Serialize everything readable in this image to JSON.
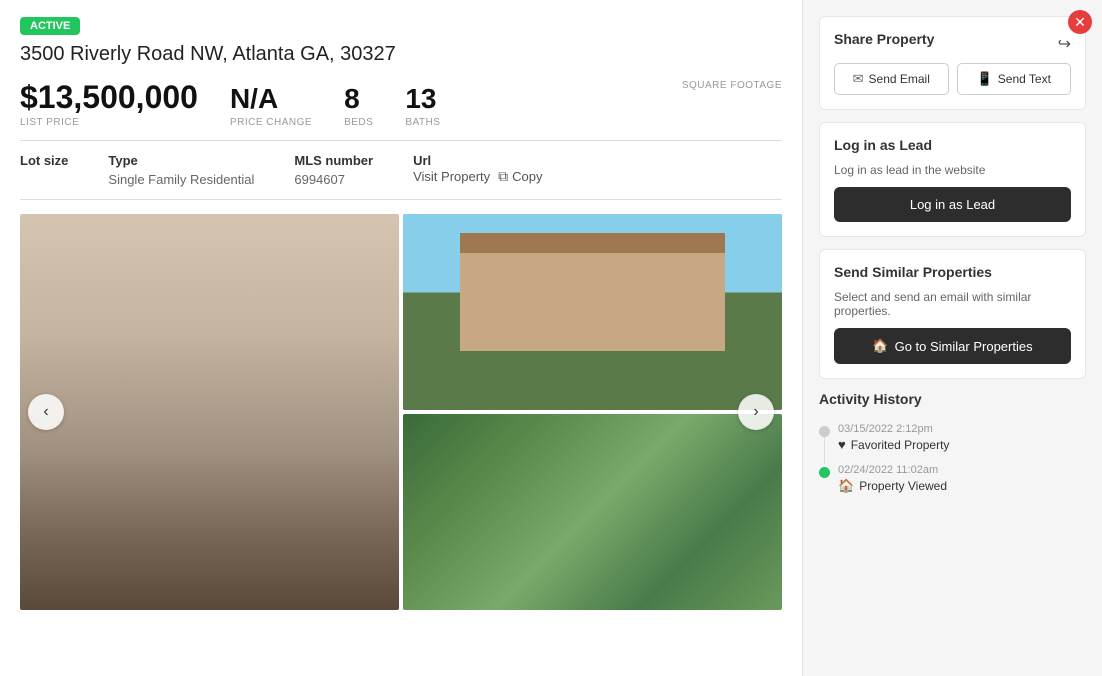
{
  "badge": "ACTIVE",
  "address": "3500 Riverly Road NW, Atlanta GA, 30327",
  "stats": {
    "list_price_value": "$13,500,000",
    "list_price_label": "LIST PRICE",
    "price_change_value": "N/A",
    "price_change_label": "PRICE CHANGE",
    "beds_value": "8",
    "beds_label": "BEDS",
    "baths_value": "13",
    "baths_label": "BATHS",
    "square_footage_label": "SQUARE FOOTAGE"
  },
  "details": {
    "lot_size_label": "Lot size",
    "lot_size_value": "",
    "type_label": "Type",
    "type_value": "Single Family Residential",
    "mls_label": "MLS number",
    "mls_value": "6994607",
    "url_label": "Url",
    "visit_label": "Visit Property",
    "copy_label": "Copy"
  },
  "nav": {
    "prev_label": "‹",
    "next_label": "›"
  },
  "right_panel": {
    "share": {
      "title": "Share Property",
      "send_email_label": "Send Email",
      "send_text_label": "Send Text"
    },
    "login_lead": {
      "title": "Log in as Lead",
      "description": "Log in as lead in the website",
      "button_label": "Log in as Lead"
    },
    "similar": {
      "title": "Send Similar Properties",
      "description": "Select and send an email with similar properties.",
      "button_label": "Go to Similar Properties"
    },
    "activity": {
      "title": "Activity History",
      "items": [
        {
          "time": "03/15/2022 2:12pm",
          "description": "Favorited Property",
          "icon": "heart",
          "dot_color": "gray"
        },
        {
          "time": "02/24/2022 11:02am",
          "description": "Property Viewed",
          "icon": "house",
          "dot_color": "green"
        }
      ]
    }
  },
  "colors": {
    "active_green": "#22c55e",
    "dark_button": "#2d2d2d",
    "close_red": "#e53e3e"
  }
}
